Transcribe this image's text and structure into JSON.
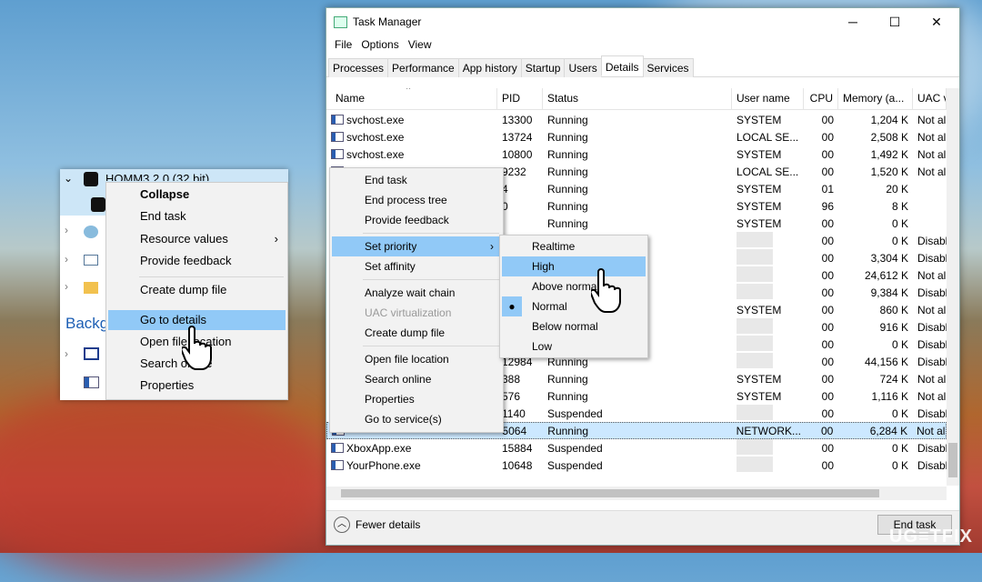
{
  "window": {
    "title": "Task Manager",
    "minimize": "─",
    "maximize": "☐",
    "close": "✕"
  },
  "menu": [
    "File",
    "Options",
    "View"
  ],
  "tabs": [
    "Processes",
    "Performance",
    "App history",
    "Startup",
    "Users",
    "Details",
    "Services"
  ],
  "active_tab": "Details",
  "columns": [
    "Name",
    "PID",
    "Status",
    "User name",
    "CPU",
    "Memory (a...",
    "UAC v"
  ],
  "rows": [
    {
      "name": "svchost.exe",
      "pid": "13300",
      "status": "Running",
      "user": "SYSTEM",
      "cpu": "00",
      "mem": "1,204 K",
      "uac": "Not al"
    },
    {
      "name": "svchost.exe",
      "pid": "13724",
      "status": "Running",
      "user": "LOCAL SE...",
      "cpu": "00",
      "mem": "2,508 K",
      "uac": "Not al"
    },
    {
      "name": "svchost.exe",
      "pid": "10800",
      "status": "Running",
      "user": "SYSTEM",
      "cpu": "00",
      "mem": "1,492 K",
      "uac": "Not al"
    },
    {
      "name": "",
      "pid": "9232",
      "status": "Running",
      "user": "LOCAL SE...",
      "cpu": "00",
      "mem": "1,520 K",
      "uac": "Not al"
    },
    {
      "name": "",
      "pid": "4",
      "status": "Running",
      "user": "SYSTEM",
      "cpu": "01",
      "mem": "20 K",
      "uac": ""
    },
    {
      "name": "",
      "pid": "0",
      "status": "Running",
      "user": "SYSTEM",
      "cpu": "96",
      "mem": "8 K",
      "uac": ""
    },
    {
      "name": "",
      "pid": "",
      "status": "Running",
      "user": "SYSTEM",
      "cpu": "00",
      "mem": "0 K",
      "uac": ""
    },
    {
      "name": "",
      "pid": "",
      "status": "",
      "user": "",
      "cpu": "00",
      "mem": "0 K",
      "uac": "Disabl"
    },
    {
      "name": "",
      "pid": "",
      "status": "",
      "user": "",
      "cpu": "00",
      "mem": "3,304 K",
      "uac": "Disabl"
    },
    {
      "name": "",
      "pid": "",
      "status": "",
      "user": "",
      "cpu": "00",
      "mem": "24,612 K",
      "uac": "Not al"
    },
    {
      "name": "",
      "pid": "",
      "status": "",
      "user": "",
      "cpu": "00",
      "mem": "9,384 K",
      "uac": "Disabl"
    },
    {
      "name": "",
      "pid": "",
      "status": "",
      "user": "SYSTEM",
      "cpu": "00",
      "mem": "860 K",
      "uac": "Not al"
    },
    {
      "name": "",
      "pid": "",
      "status": "",
      "user": "",
      "cpu": "00",
      "mem": "916 K",
      "uac": "Disabl"
    },
    {
      "name": "",
      "pid": "",
      "status": "",
      "user": "",
      "cpu": "00",
      "mem": "0 K",
      "uac": "Disabl"
    },
    {
      "name": "",
      "pid": "12984",
      "status": "Running",
      "user": "",
      "cpu": "00",
      "mem": "44,156 K",
      "uac": "Disabl"
    },
    {
      "name": "",
      "pid": "388",
      "status": "Running",
      "user": "SYSTEM",
      "cpu": "00",
      "mem": "724 K",
      "uac": "Not al"
    },
    {
      "name": "",
      "pid": "576",
      "status": "Running",
      "user": "SYSTEM",
      "cpu": "00",
      "mem": "1,116 K",
      "uac": "Not al"
    },
    {
      "name": "",
      "pid": "1140",
      "status": "Suspended",
      "user": "",
      "cpu": "00",
      "mem": "0 K",
      "uac": "Disabl"
    },
    {
      "name": "",
      "pid": "5064",
      "status": "Running",
      "user": "NETWORK...",
      "cpu": "00",
      "mem": "6,284 K",
      "uac": "Not al"
    },
    {
      "name": "XboxApp.exe",
      "pid": "15884",
      "status": "Suspended",
      "user": "",
      "cpu": "00",
      "mem": "0 K",
      "uac": "Disabl"
    },
    {
      "name": "YourPhone.exe",
      "pid": "10648",
      "status": "Suspended",
      "user": "",
      "cpu": "00",
      "mem": "0 K",
      "uac": "Disabl"
    }
  ],
  "selected_row": 18,
  "footer": {
    "fewer_details": "Fewer details",
    "end_task": "End task"
  },
  "context_menu": [
    "End task",
    "End process tree",
    "Provide feedback",
    "Set priority",
    "Set affinity",
    "Analyze wait chain",
    "UAC virtualization",
    "Create dump file",
    "Open file location",
    "Search online",
    "Properties",
    "Go to service(s)"
  ],
  "priority_menu": [
    "Realtime",
    "High",
    "Above normal",
    "Normal",
    "Below normal",
    "Low"
  ],
  "priority_current": "Normal",
  "priority_hover": "High",
  "left_panel": {
    "app_title": "HOMM3 2.0 (32 bit)",
    "section": "Background processes",
    "menu": [
      "Collapse",
      "End task",
      "Resource values",
      "Provide feedback",
      "Create dump file",
      "Go to details",
      "Open file location",
      "Search online",
      "Properties"
    ]
  },
  "watermark": "UG≡TFIX",
  "colors": {
    "highlight": "#91c9f7",
    "selected_row": "#cce8ff"
  }
}
